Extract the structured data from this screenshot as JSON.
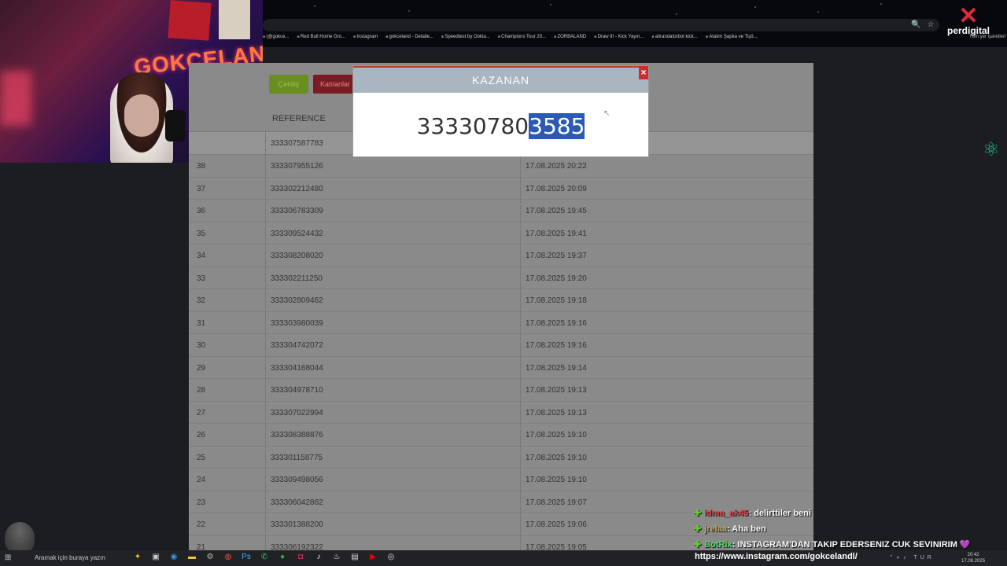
{
  "browser": {
    "bookmarks": [
      "(@gokce...",
      "Red Bull Home Gro...",
      "Instagram",
      "gokceland - Detaile...",
      "Speedtest by Ookla...",
      "Champions Tour 20...",
      "ZORBALAND",
      "Draw It! - Kick Yayın...",
      "aitrandatorbot kick...",
      "Atalım Şapka ve Tişö..."
    ],
    "brand": "perdigital",
    "side_note": "Tüm yer işaretleri"
  },
  "webcam": {
    "sign": "GOKCELAND"
  },
  "page": {
    "tab_draw": "Çekiliş",
    "tab_participants": "Katılanlar",
    "column_reference": "REFERENCE",
    "first_row_ref": "333307587783",
    "rows": [
      {
        "num": "38",
        "ref": "333307955126",
        "date": "17.08.2025 20:22"
      },
      {
        "num": "37",
        "ref": "333302212480",
        "date": "17.08.2025 20:09"
      },
      {
        "num": "36",
        "ref": "333306783309",
        "date": "17.08.2025 19:45"
      },
      {
        "num": "35",
        "ref": "333309524432",
        "date": "17.08.2025 19:41"
      },
      {
        "num": "34",
        "ref": "333308208020",
        "date": "17.08.2025 19:37"
      },
      {
        "num": "33",
        "ref": "333302211250",
        "date": "17.08.2025 19:20"
      },
      {
        "num": "32",
        "ref": "333302809462",
        "date": "17.08.2025 19:18"
      },
      {
        "num": "31",
        "ref": "333303980039",
        "date": "17.08.2025 19:16"
      },
      {
        "num": "30",
        "ref": "333304742072",
        "date": "17.08.2025 19:16"
      },
      {
        "num": "29",
        "ref": "333304168044",
        "date": "17.08.2025 19:14"
      },
      {
        "num": "28",
        "ref": "333304978710",
        "date": "17.08.2025 19:13"
      },
      {
        "num": "27",
        "ref": "333307022994",
        "date": "17.08.2025 19:13"
      },
      {
        "num": "26",
        "ref": "333308388876",
        "date": "17.08.2025 19:10"
      },
      {
        "num": "25",
        "ref": "333301158775",
        "date": "17.08.2025 19:10"
      },
      {
        "num": "24",
        "ref": "333309498056",
        "date": "17.08.2025 19:10"
      },
      {
        "num": "23",
        "ref": "333306042862",
        "date": "17.08.2025 19:07"
      },
      {
        "num": "22",
        "ref": "333301388200",
        "date": "17.08.2025 19:06"
      },
      {
        "num": "21",
        "ref": "333306192322",
        "date": "17.08.2025 19:05"
      }
    ]
  },
  "modal": {
    "title": "KAZANAN",
    "close": "×",
    "number_plain": "33330780",
    "number_highlight": "3585"
  },
  "chat": [
    {
      "user": "idma_ak45",
      "text": ": delirttiler beni"
    },
    {
      "user": "jrelaa",
      "text": ": Aha ben"
    },
    {
      "user": "BotRix",
      "text": ": INSTAGRAM'DAN TAKIP EDERSENIZ CUK SEVINIRIM",
      "heart": "💜"
    }
  ],
  "overlay_url": "https://www.instagram.com/gokcelandl/",
  "taskbar": {
    "search_placeholder": "Aramak için buraya yazın",
    "lang": "TUR",
    "time": "20:42",
    "date": "17.08.2025"
  },
  "colors": {
    "modal_header": "#a9b5bf",
    "highlight": "#2b5ab4",
    "close": "#d12a2a"
  }
}
